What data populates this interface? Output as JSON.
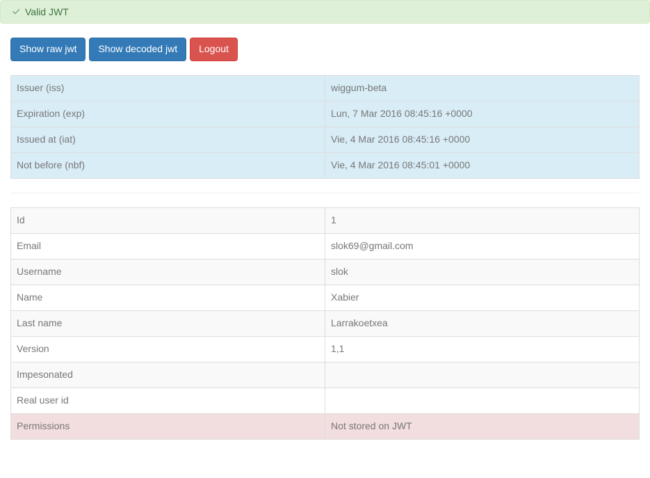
{
  "alert": {
    "message": "Valid JWT"
  },
  "buttons": {
    "show_raw": "Show raw jwt",
    "show_decoded": "Show decoded jwt",
    "logout": "Logout"
  },
  "claims": [
    {
      "label": "Issuer (iss)",
      "value": "wiggum-beta"
    },
    {
      "label": "Expiration (exp)",
      "value": "Lun, 7 Mar 2016 08:45:16 +0000"
    },
    {
      "label": "Issued at (iat)",
      "value": "Vie, 4 Mar 2016 08:45:16 +0000"
    },
    {
      "label": "Not before (nbf)",
      "value": "Vie, 4 Mar 2016 08:45:01 +0000"
    }
  ],
  "user": [
    {
      "label": "Id",
      "value": "1",
      "danger": false
    },
    {
      "label": "Email",
      "value": "slok69@gmail.com",
      "danger": false
    },
    {
      "label": "Username",
      "value": "slok",
      "danger": false
    },
    {
      "label": "Name",
      "value": "Xabier",
      "danger": false
    },
    {
      "label": "Last name",
      "value": "Larrakoetxea",
      "danger": false
    },
    {
      "label": "Version",
      "value": "1,1",
      "danger": false
    },
    {
      "label": "Impesonated",
      "value": "",
      "danger": false
    },
    {
      "label": "Real user id",
      "value": "",
      "danger": false
    },
    {
      "label": "Permissions",
      "value": "Not stored on JWT",
      "danger": true
    }
  ]
}
